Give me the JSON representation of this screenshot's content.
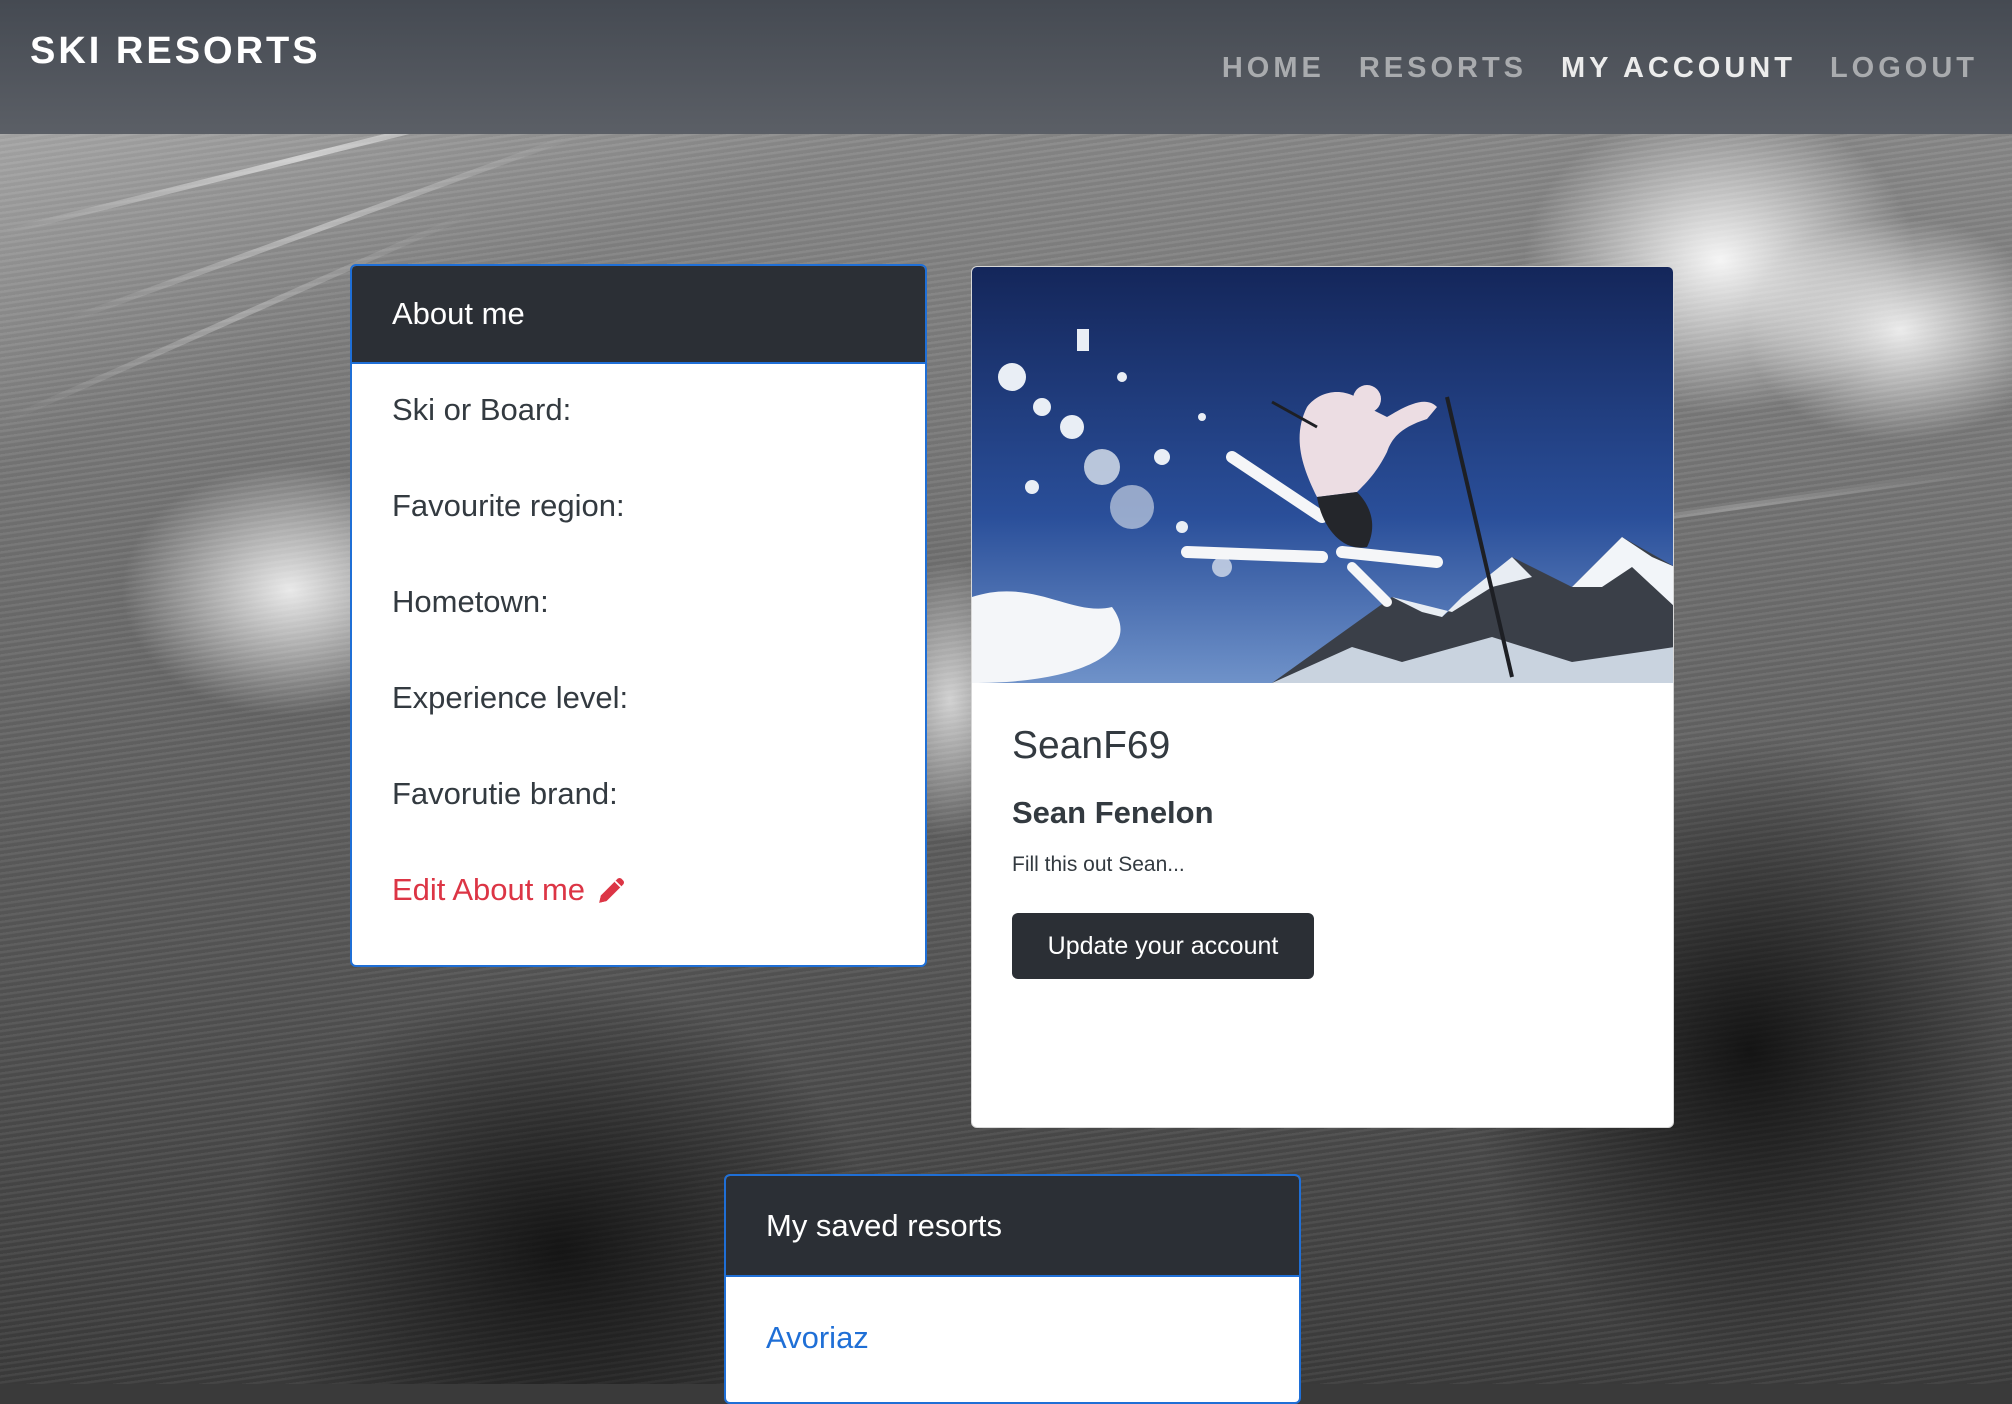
{
  "navbar": {
    "brand": "SKI RESORTS",
    "links": [
      {
        "label": "HOME",
        "active": false
      },
      {
        "label": "RESORTS",
        "active": false
      },
      {
        "label": "MY ACCOUNT",
        "active": true
      },
      {
        "label": "LOGOUT",
        "active": false
      }
    ]
  },
  "about": {
    "title": "About me",
    "fields": [
      "Ski or Board:",
      "Favourite region:",
      "Hometown:",
      "Experience level:",
      "Favorutie brand:"
    ],
    "edit_label": "Edit About me",
    "edit_icon": "pencil-icon"
  },
  "profile": {
    "username": "SeanF69",
    "full_name": "Sean Fenelon",
    "bio": "Fill this out Sean...",
    "update_label": "Update your account",
    "image": "skier-jumping-photo"
  },
  "saved": {
    "title": "My saved resorts",
    "resorts": [
      "Avoriaz"
    ]
  },
  "colors": {
    "navbar": "#4f545b",
    "card_header": "#2b2f35",
    "card_border": "#1f6fd6",
    "edit_link": "#dc3545",
    "resort_link": "#1f6fd6"
  }
}
